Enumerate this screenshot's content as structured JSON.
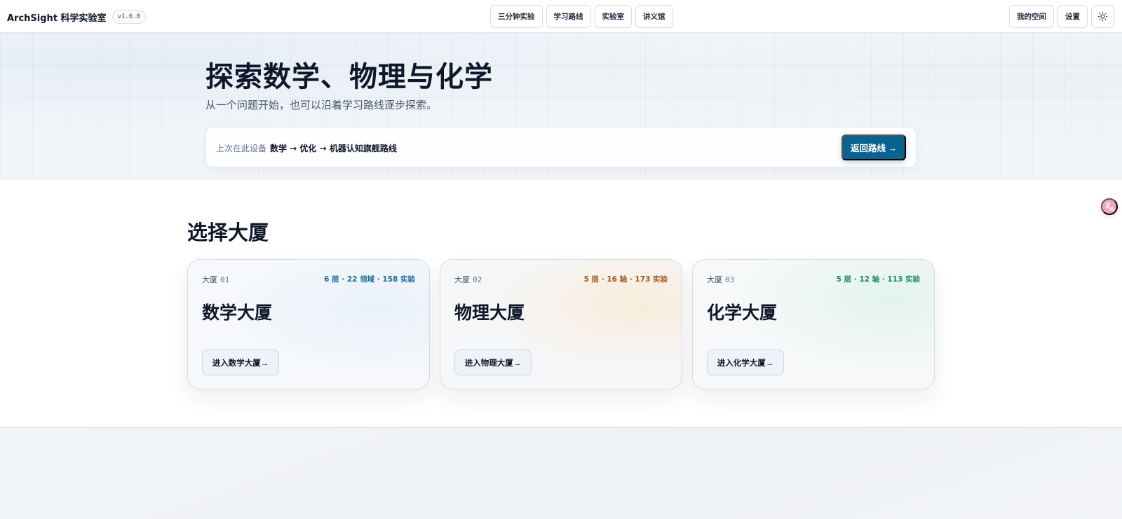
{
  "header": {
    "brand": "ArchSight 科学实验室",
    "version": "v1.6.0",
    "nav": [
      "三分钟实验",
      "学习路线",
      "实验室",
      "讲义馆"
    ],
    "my_space": "我的空间",
    "settings": "设置",
    "theme_icon": "sun-icon"
  },
  "hero": {
    "title": "探索数学、物理与化学",
    "subtitle": "从一个问题开始，也可以沿着学习路线逐步探索。",
    "resume": {
      "label": "上次在此设备",
      "path": "数学 → 优化 → 机器认知旗舰路线",
      "button": "返回路线 →"
    }
  },
  "section": {
    "title": "选择大厦",
    "cards": [
      {
        "index_label": "大厦",
        "index_num": "01",
        "stats": "6 层 · 22 领域 · 158 实验",
        "title": "数学大厦",
        "button": "进入数学大厦→",
        "accent": "#1d6b9a"
      },
      {
        "index_label": "大厦",
        "index_num": "02",
        "stats": "5 层 · 16 轴 · 173 实验",
        "title": "物理大厦",
        "button": "进入物理大厦→",
        "accent": "#a2561a"
      },
      {
        "index_label": "大厦",
        "index_num": "03",
        "stats": "5 层 · 12 轴 · 113 实验",
        "title": "化学大厦",
        "button": "进入化学大厦→",
        "accent": "#1d8a5e"
      }
    ]
  },
  "floating": {
    "translate_icon": "translate-icon"
  },
  "colors": {
    "primary": "#0b628f"
  }
}
